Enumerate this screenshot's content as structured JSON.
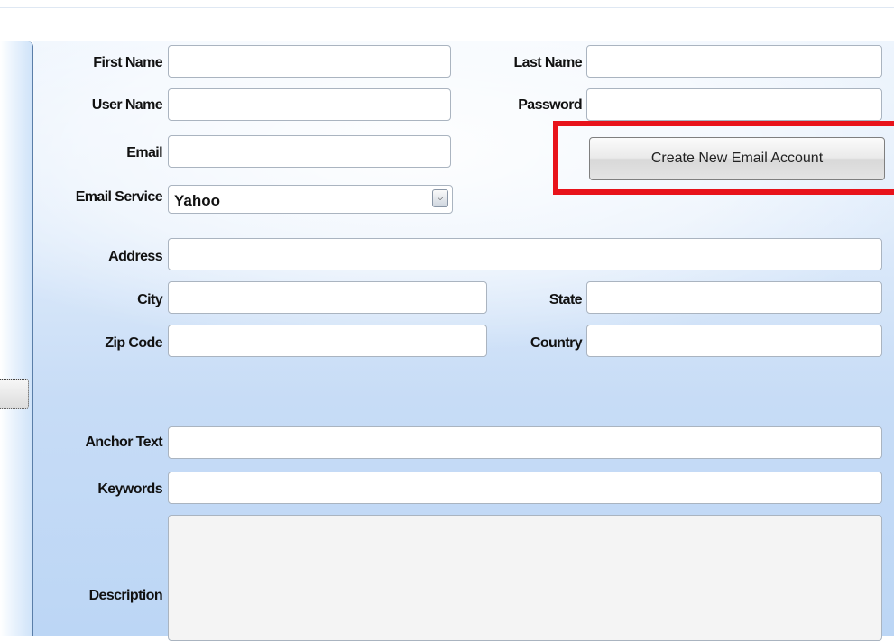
{
  "form": {
    "first_name_label": "First Name",
    "last_name_label": "Last Name",
    "user_name_label": "User Name",
    "password_label": "Password",
    "email_label": "Email",
    "email_service_label": "Email Service",
    "email_service_value": "Yahoo",
    "create_button_label": "Create New Email Account",
    "address_label": "Address",
    "city_label": "City",
    "state_label": "State",
    "zip_label": "Zip Code",
    "country_label": "Country",
    "anchor_text_label": "Anchor Text",
    "keywords_label": "Keywords",
    "description_label": "Description",
    "first_name_value": "",
    "last_name_value": "",
    "user_name_value": "",
    "password_value": "",
    "email_value": "",
    "address_value": "",
    "city_value": "",
    "state_value": "",
    "zip_value": "",
    "country_value": "",
    "anchor_text_value": "",
    "keywords_value": "",
    "description_value": ""
  },
  "colors": {
    "highlight": "#e8131b",
    "panel_gradient_top": "#eef5fd",
    "panel_gradient_bottom": "#bcd6f5"
  },
  "icons": {
    "dropdown": "chevron-down-icon"
  }
}
